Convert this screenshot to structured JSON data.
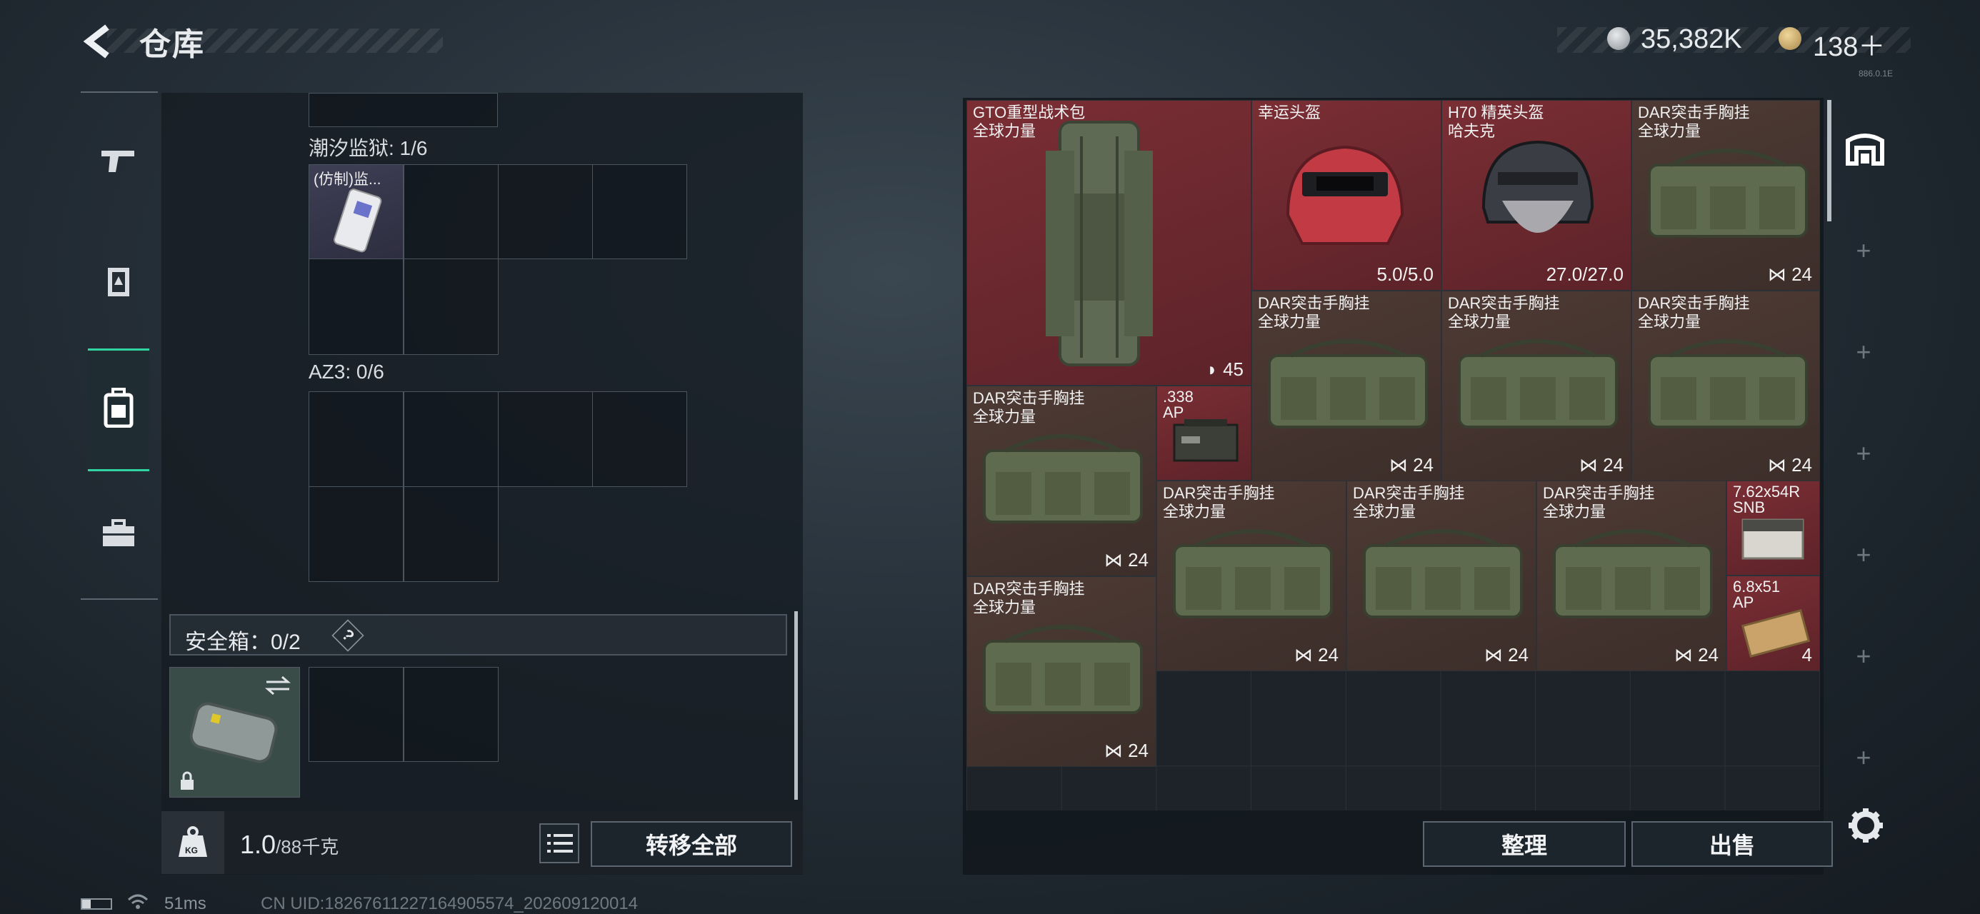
{
  "header": {
    "back_label": "返回",
    "title": "仓库",
    "currency_primary": "35,382K",
    "currency_secondary": "138＋",
    "version_tag": "886.0.1E"
  },
  "sidebar": {
    "icons": [
      "weapon-icon",
      "armor-icon",
      "backpack-icon",
      "briefcase-icon"
    ],
    "active_index": 2
  },
  "left_panel": {
    "sections": [
      {
        "label": "潮汐监狱: 1/6",
        "item_label": "(仿制)监..."
      },
      {
        "label": "AZ3: 0/6"
      }
    ],
    "safe_box": {
      "label": "安全箱：0/2",
      "help": "?"
    },
    "weight": "1.0",
    "weight_max": "/88千克",
    "weight_icon_label": "KG",
    "transfer_all": "转移全部"
  },
  "inventory": {
    "items": [
      {
        "name": "GTO重型战术包",
        "sub": "全球力量",
        "count": "45"
      },
      {
        "name": "幸运头盔",
        "sub": "",
        "count": "5.0/5.0"
      },
      {
        "name": "H70 精英头盔",
        "sub": "哈夫克",
        "count": "27.0/27.0"
      },
      {
        "name": "DAR突击手胸挂",
        "sub": "全球力量",
        "count": "24"
      },
      {
        "name": "DAR突击手胸挂",
        "sub": "全球力量",
        "count": "24"
      },
      {
        "name": "DAR突击手胸挂",
        "sub": "全球力量",
        "count": "24"
      },
      {
        "name": "DAR突击手胸挂",
        "sub": "全球力量",
        "count": "24"
      },
      {
        "name": "DAR突击手胸挂",
        "sub": "全球力量",
        "count": "24"
      },
      {
        "name": ".338",
        "sub": "AP",
        "count": ""
      },
      {
        "name": "DAR突击手胸挂",
        "sub": "全球力量",
        "count": "24"
      },
      {
        "name": "DAR突击手胸挂",
        "sub": "全球力量",
        "count": "24"
      },
      {
        "name": "DAR突击手胸挂",
        "sub": "全球力量",
        "count": "24"
      },
      {
        "name": "7.62x54R",
        "sub": "SNB",
        "count": ""
      },
      {
        "name": "DAR突击手胸挂",
        "sub": "全球力量",
        "count": "24"
      },
      {
        "name": "6.8x51",
        "sub": "AP",
        "count": "4"
      }
    ],
    "sort_button": "整理",
    "sell_button": "出售"
  },
  "status_bar": {
    "ping": "51ms",
    "uid": "CN UID:182676112271649055​74_202609120014"
  },
  "colors": {
    "accent": "#2fd4a0",
    "item_red": "#6f2a30",
    "item_brown": "#46352f"
  }
}
